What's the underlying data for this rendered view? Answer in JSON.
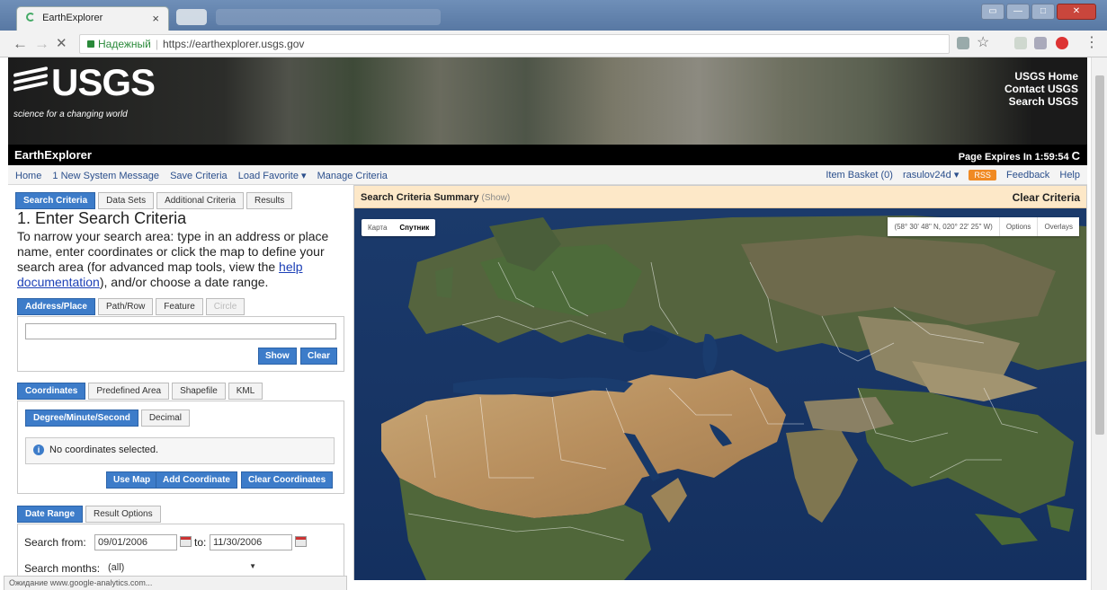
{
  "browser": {
    "tab_title": "EarthExplorer",
    "tab_close": "×",
    "back": "←",
    "forward": "→",
    "stop": "✕",
    "secure_label": "Надежный",
    "url": "https://earthexplorer.usgs.gov",
    "bookmark_star": "☆",
    "menu": "⋮",
    "window_buttons": [
      "▭",
      "—",
      "□",
      "✕"
    ]
  },
  "header": {
    "logo_text": "USGS",
    "logo_tagline": "science for a changing world",
    "top_links": [
      "USGS Home",
      "Contact USGS",
      "Search USGS"
    ],
    "app_title": "EarthExplorer",
    "page_expires": "Page Expires In 1:59:54",
    "refresh_glyph": "C"
  },
  "menu": {
    "left": [
      "Home",
      "1 New System Message",
      "Save Criteria",
      "Load Favorite ▾",
      "Manage Criteria"
    ],
    "basket": "Item Basket (0)",
    "user": "rasulov24d ▾",
    "rss": "RSS",
    "feedback": "Feedback",
    "help": "Help"
  },
  "main_tabs": [
    "Search Criteria",
    "Data Sets",
    "Additional Criteria",
    "Results"
  ],
  "step": {
    "title": "1. Enter Search Criteria",
    "text_before_link": "To narrow your search area: type in an address or place name, enter coordinates or click the map to define your search area (for advanced map tools, view the ",
    "link": "help documentation",
    "text_after_link": "), and/or choose a date range."
  },
  "location_tabs": [
    "Address/Place",
    "Path/Row",
    "Feature",
    "Circle"
  ],
  "address": {
    "value": "",
    "show": "Show",
    "clear": "Clear"
  },
  "coord_tabs": [
    "Coordinates",
    "Predefined Area",
    "Shapefile",
    "KML"
  ],
  "format_tabs": [
    "Degree/Minute/Second",
    "Decimal"
  ],
  "coords": {
    "info_glyph": "i",
    "notice": "No coordinates selected.",
    "use_map": "Use Map",
    "add": "Add Coordinate",
    "clear": "Clear Coordinates"
  },
  "date_tabs": [
    "Date Range",
    "Result Options"
  ],
  "dates": {
    "from_label": "Search from:",
    "from": "09/01/2006",
    "to_label": "to:",
    "to": "11/30/2006",
    "months_label": "Search months:",
    "months_value": "(all)"
  },
  "summary": {
    "title": "Search Criteria Summary",
    "show": "(Show)",
    "clear": "Clear Criteria"
  },
  "map": {
    "type_buttons": [
      "Карта",
      "Спутник"
    ],
    "coordinate_readout": "(58° 30' 48\" N, 020° 22' 25\" W)",
    "options": "Options",
    "overlays": "Overlays"
  },
  "status": "Ожидание www.google-analytics.com..."
}
